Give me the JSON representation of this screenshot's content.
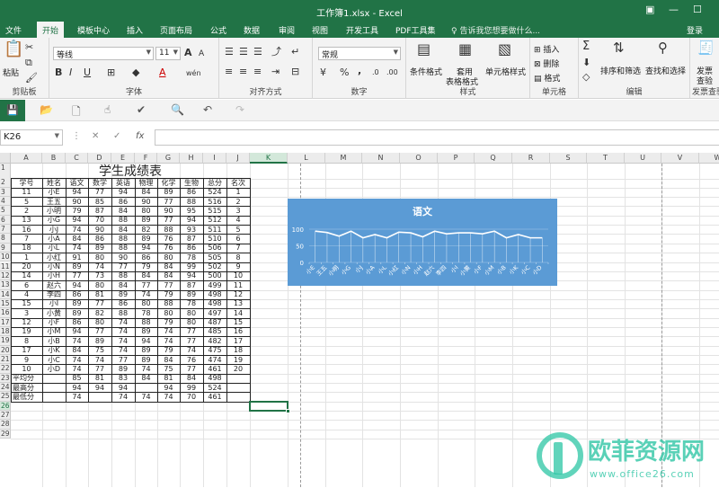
{
  "window": {
    "title": "工作簿1.xlsx - Excel"
  },
  "menu": {
    "tabs": [
      "文件",
      "开始",
      "模板中心",
      "插入",
      "页面布局",
      "公式",
      "数据",
      "审阅",
      "视图",
      "开发工具",
      "PDF工具集"
    ],
    "active": "开始",
    "tell_me": "告诉我您想要做什么...",
    "login": "登录"
  },
  "ribbon": {
    "clipboard": {
      "label": "剪贴板",
      "paste": "粘贴"
    },
    "font": {
      "label": "字体",
      "name": "等线",
      "size": "11",
      "bold": "B",
      "italic": "I",
      "underline": "U",
      "grow": "A",
      "shrink": "A",
      "color": "A",
      "phonetic": "wén"
    },
    "align": {
      "label": "对齐方式"
    },
    "number": {
      "label": "数字",
      "format": "常规",
      "percent": "%",
      "comma": ","
    },
    "styles": {
      "label": "样式",
      "cond": "条件格式",
      "table1": "套用",
      "table2": "表格格式",
      "cell": "单元格样式"
    },
    "cells": {
      "label": "单元格",
      "insert": "插入",
      "delete": "删除",
      "format": "格式"
    },
    "edit": {
      "label": "编辑",
      "sort": "排序和筛选",
      "find": "查找和选择",
      "sigma": "Σ"
    },
    "invoice": {
      "label": "发票查验",
      "line1": "发票",
      "line2": "查验"
    }
  },
  "formula_bar": {
    "name_box": "K26",
    "cancel": "✕",
    "confirm": "✓",
    "fx": "fx",
    "value": ""
  },
  "sheet": {
    "columns": [
      "A",
      "B",
      "C",
      "D",
      "E",
      "F",
      "G",
      "H",
      "I",
      "J",
      "K",
      "L",
      "M",
      "N",
      "O",
      "P",
      "Q",
      "R",
      "S",
      "T",
      "U",
      "V",
      "W"
    ],
    "active_col": "K",
    "active_row": 26,
    "row_numbers": [
      "1",
      "2",
      "3",
      "4",
      "5",
      "6",
      "7",
      "8",
      "9",
      "10",
      "11",
      "12",
      "13",
      "14",
      "15",
      "16",
      "17",
      "18",
      "19",
      "20",
      "21",
      "22",
      "23",
      "24",
      "25",
      "26",
      "27",
      "28",
      "29"
    ],
    "title": "学生成绩表",
    "headers": [
      "学号",
      "姓名",
      "语文",
      "数学",
      "英语",
      "物理",
      "化学",
      "生物",
      "总分",
      "名次"
    ],
    "rows": [
      [
        "11",
        "小E",
        "94",
        "77",
        "94",
        "84",
        "89",
        "86",
        "524",
        "1"
      ],
      [
        "5",
        "王五",
        "90",
        "85",
        "86",
        "90",
        "77",
        "88",
        "516",
        "2"
      ],
      [
        "2",
        "小明",
        "79",
        "87",
        "84",
        "80",
        "90",
        "95",
        "515",
        "3"
      ],
      [
        "13",
        "小G",
        "94",
        "70",
        "88",
        "89",
        "77",
        "94",
        "512",
        "4"
      ],
      [
        "16",
        "小J",
        "74",
        "90",
        "84",
        "82",
        "88",
        "93",
        "511",
        "5"
      ],
      [
        "7",
        "小A",
        "84",
        "86",
        "88",
        "89",
        "76",
        "87",
        "510",
        "6"
      ],
      [
        "18",
        "小L",
        "74",
        "89",
        "88",
        "94",
        "76",
        "86",
        "506",
        "7"
      ],
      [
        "1",
        "小红",
        "91",
        "80",
        "90",
        "86",
        "80",
        "78",
        "505",
        "8"
      ],
      [
        "20",
        "小N",
        "89",
        "74",
        "77",
        "79",
        "84",
        "99",
        "502",
        "9"
      ],
      [
        "14",
        "小H",
        "77",
        "73",
        "88",
        "84",
        "84",
        "94",
        "500",
        "10"
      ],
      [
        "6",
        "赵六",
        "94",
        "80",
        "84",
        "77",
        "77",
        "87",
        "499",
        "11"
      ],
      [
        "4",
        "李四",
        "86",
        "81",
        "89",
        "74",
        "79",
        "89",
        "498",
        "12"
      ],
      [
        "15",
        "小I",
        "89",
        "77",
        "86",
        "80",
        "88",
        "78",
        "498",
        "13"
      ],
      [
        "3",
        "小黄",
        "89",
        "82",
        "88",
        "78",
        "80",
        "80",
        "497",
        "14"
      ],
      [
        "12",
        "小F",
        "86",
        "80",
        "74",
        "88",
        "79",
        "80",
        "487",
        "15"
      ],
      [
        "19",
        "小M",
        "94",
        "77",
        "74",
        "89",
        "74",
        "77",
        "485",
        "16"
      ],
      [
        "8",
        "小B",
        "74",
        "89",
        "74",
        "94",
        "74",
        "77",
        "482",
        "17"
      ],
      [
        "17",
        "小K",
        "84",
        "75",
        "74",
        "89",
        "79",
        "74",
        "475",
        "18"
      ],
      [
        "9",
        "小C",
        "74",
        "74",
        "77",
        "89",
        "84",
        "76",
        "474",
        "19"
      ],
      [
        "10",
        "小D",
        "74",
        "77",
        "89",
        "74",
        "75",
        "77",
        "461",
        "20"
      ]
    ],
    "summary": [
      {
        "label": "平均分",
        "values": [
          "85",
          "81",
          "83",
          "84",
          "81",
          "84",
          "498"
        ]
      },
      {
        "label": "最高分",
        "values": [
          "94",
          "94",
          "94",
          "",
          "94",
          "99",
          "524"
        ]
      },
      {
        "label": "最低分",
        "values": [
          "74",
          "",
          "74",
          "74",
          "74",
          "70",
          "461"
        ]
      }
    ]
  },
  "chart_data": {
    "type": "line",
    "title": "语文",
    "categories": [
      "小E",
      "王五",
      "小明",
      "小G",
      "小J",
      "小A",
      "小L",
      "小红",
      "小N",
      "小H",
      "赵六",
      "李四",
      "小I",
      "小黄",
      "小F",
      "小M",
      "小B",
      "小K",
      "小C",
      "小D"
    ],
    "values": [
      94,
      90,
      79,
      94,
      74,
      84,
      74,
      91,
      89,
      77,
      94,
      86,
      89,
      89,
      86,
      94,
      74,
      84,
      74,
      74
    ],
    "ylim": [
      0,
      100
    ],
    "yticks": [
      "0",
      "50",
      "100"
    ],
    "grid": true,
    "colors": {
      "background": "#5b9bd5",
      "line": "#ffffff"
    }
  },
  "watermark": {
    "brand": "欧菲资源网",
    "url": "www.office26.com"
  },
  "colors": {
    "accent": "#217346",
    "chart_bg": "#5b9bd5",
    "watermark": "#2cc5a4"
  }
}
